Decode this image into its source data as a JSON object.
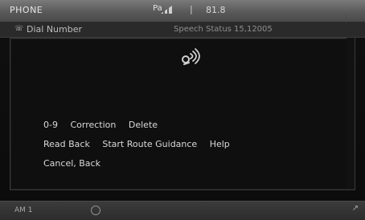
{
  "status": {
    "title": "PHONE",
    "signal_text": "Pa",
    "sep": "|",
    "clock": "81.8"
  },
  "header": {
    "label": "Dial Number",
    "right_text": "Speech Status 15,12005"
  },
  "voice_panel": {
    "icon": "voice-recognition-icon",
    "line1": [
      "0-9",
      "Correction",
      "Delete"
    ],
    "line2": [
      "Read Back",
      "Start Route Guidance",
      "Help"
    ],
    "line3": "Cancel, Back"
  },
  "bottom": {
    "temp": "AM 1"
  }
}
